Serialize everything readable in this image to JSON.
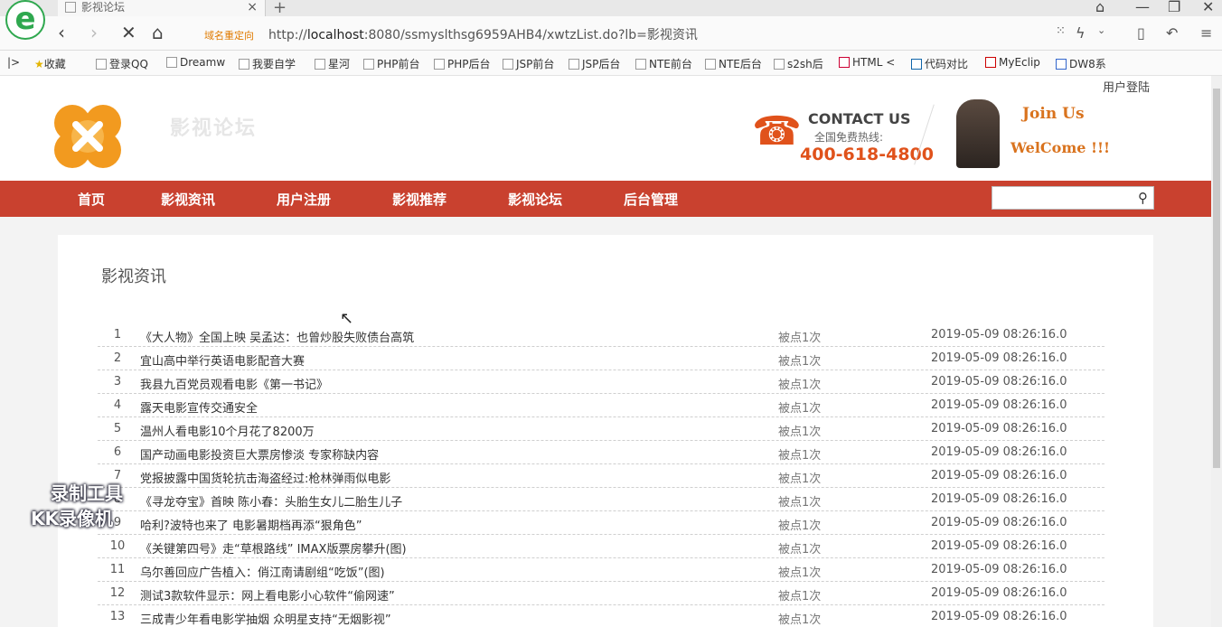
{
  "browser": {
    "logo_letter": "e",
    "tab_title": "影视论坛",
    "tab_close": "×",
    "new_tab": "+",
    "redirect_label": "域名重定向",
    "url_prefix": "http://",
    "url_host": "localhost",
    "url_rest": ":8080/ssmyslthsg6959AHB4/xwtzList.do?lb=影视资讯",
    "bookmarks": [
      "收藏",
      "登录QQ",
      "Dreamw",
      "我要自学",
      "星河",
      "PHP前台",
      "PHP后台",
      "JSP前台",
      "JSP后台",
      "NTE前台",
      "NTE后台",
      "s2sh后",
      "HTML <",
      "代码对比",
      "MyEclip",
      "DW8系"
    ]
  },
  "header": {
    "login_link": "用户登陆",
    "site_title": "影视论坛",
    "contact_us": "CONTACT US",
    "hotline_label": "全国免费热线:",
    "hotline_number": "400-618-4800",
    "join_us": "Join Us",
    "welcome": "WelCome !!!"
  },
  "menu": {
    "items": [
      "首页",
      "影视资讯",
      "用户注册",
      "影视推荐",
      "影视论坛",
      "后台管理"
    ]
  },
  "search": {
    "placeholder": ""
  },
  "main": {
    "section_title": "影视资讯",
    "rows": [
      {
        "num": "1",
        "title": "《大人物》全国上映 吴孟达：也曾炒股失败债台高筑",
        "views": "被点1次",
        "date": "2019-05-09 08:26:16.0"
      },
      {
        "num": "2",
        "title": "宜山高中举行英语电影配音大赛",
        "views": "被点1次",
        "date": "2019-05-09 08:26:16.0"
      },
      {
        "num": "3",
        "title": "我县九百党员观看电影《第一书记》",
        "views": "被点1次",
        "date": "2019-05-09 08:26:16.0"
      },
      {
        "num": "4",
        "title": "露天电影宣传交通安全",
        "views": "被点1次",
        "date": "2019-05-09 08:26:16.0"
      },
      {
        "num": "5",
        "title": "温州人看电影10个月花了8200万",
        "views": "被点1次",
        "date": "2019-05-09 08:26:16.0"
      },
      {
        "num": "6",
        "title": "国产动画电影投资巨大票房惨淡 专家称缺内容",
        "views": "被点1次",
        "date": "2019-05-09 08:26:16.0"
      },
      {
        "num": "7",
        "title": "党报披露中国货轮抗击海盗经过:枪林弹雨似电影",
        "views": "被点1次",
        "date": "2019-05-09 08:26:16.0"
      },
      {
        "num": "8",
        "title": "《寻龙夺宝》首映 陈小春：头胎生女儿二胎生儿子",
        "views": "被点1次",
        "date": "2019-05-09 08:26:16.0"
      },
      {
        "num": "9",
        "title": "哈利?波特也来了 电影暑期档再添“狠角色”",
        "views": "被点1次",
        "date": "2019-05-09 08:26:16.0"
      },
      {
        "num": "10",
        "title": "《关键第四号》走“草根路线” IMAX版票房攀升(图)",
        "views": "被点1次",
        "date": "2019-05-09 08:26:16.0"
      },
      {
        "num": "11",
        "title": "乌尔善回应广告植入：俏江南请剧组“吃饭”(图)",
        "views": "被点1次",
        "date": "2019-05-09 08:26:16.0"
      },
      {
        "num": "12",
        "title": "测试3款软件显示：网上看电影小心软件“偷网速”",
        "views": "被点1次",
        "date": "2019-05-09 08:26:16.0"
      },
      {
        "num": "13",
        "title": "三成青少年看电影学抽烟 众明星支持“无烟影视”",
        "views": "被点1次",
        "date": "2019-05-09 08:26:16.0"
      }
    ]
  },
  "watermark": {
    "line1": "录制工具",
    "line2": "KK录像机"
  },
  "colors": {
    "menu_bg": "#c9412f",
    "accent_orange": "#e0521b"
  }
}
